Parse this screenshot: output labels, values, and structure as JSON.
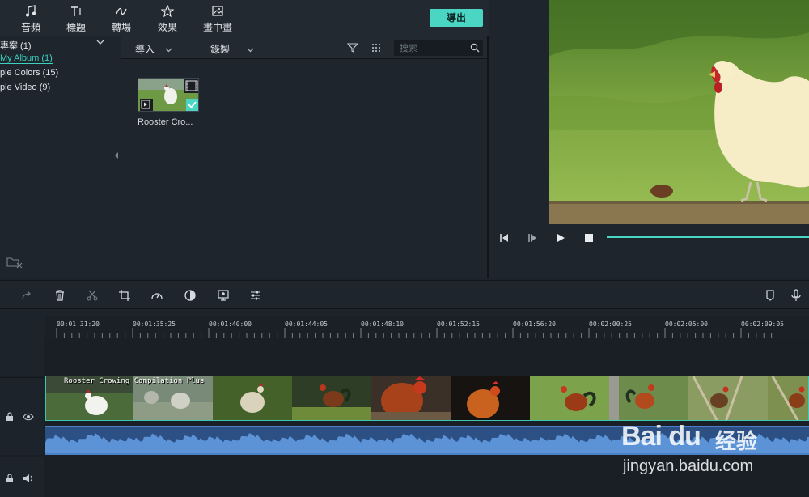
{
  "toolbar": {
    "items": [
      {
        "label": "音頻",
        "icon": "music-note-icon"
      },
      {
        "label": "標題",
        "icon": "title-text-icon"
      },
      {
        "label": "轉場",
        "icon": "transition-icon"
      },
      {
        "label": "效果",
        "icon": "effects-icon"
      },
      {
        "label": "畫中畫",
        "icon": "picture-in-picture-icon"
      }
    ],
    "export_label": "導出",
    "accent": "#4bd6c4"
  },
  "sidebar": {
    "items": [
      {
        "label": "專案 (1)"
      },
      {
        "label": "My Album (1)"
      },
      {
        "label": "ple Colors (15)"
      },
      {
        "label": "ple Video (9)"
      }
    ]
  },
  "media": {
    "import_label": "導入",
    "record_label": "錄製",
    "search_placeholder": "搜索",
    "clip_name": "Rooster Cro..."
  },
  "timeline": {
    "timecodes": [
      "00:01:31:20",
      "00:01:35:25",
      "00:01:40:00",
      "00:01:44:05",
      "00:01:48:10",
      "00:01:52:15",
      "00:01:56:20",
      "00:02:00:25",
      "00:02:05:00",
      "00:02:09:05"
    ],
    "clip_title": "Rooster Crowing Compilation Plus"
  },
  "watermark": {
    "brand": "Bai du",
    "cn": "经验",
    "url": "jingyan.baidu.com"
  }
}
